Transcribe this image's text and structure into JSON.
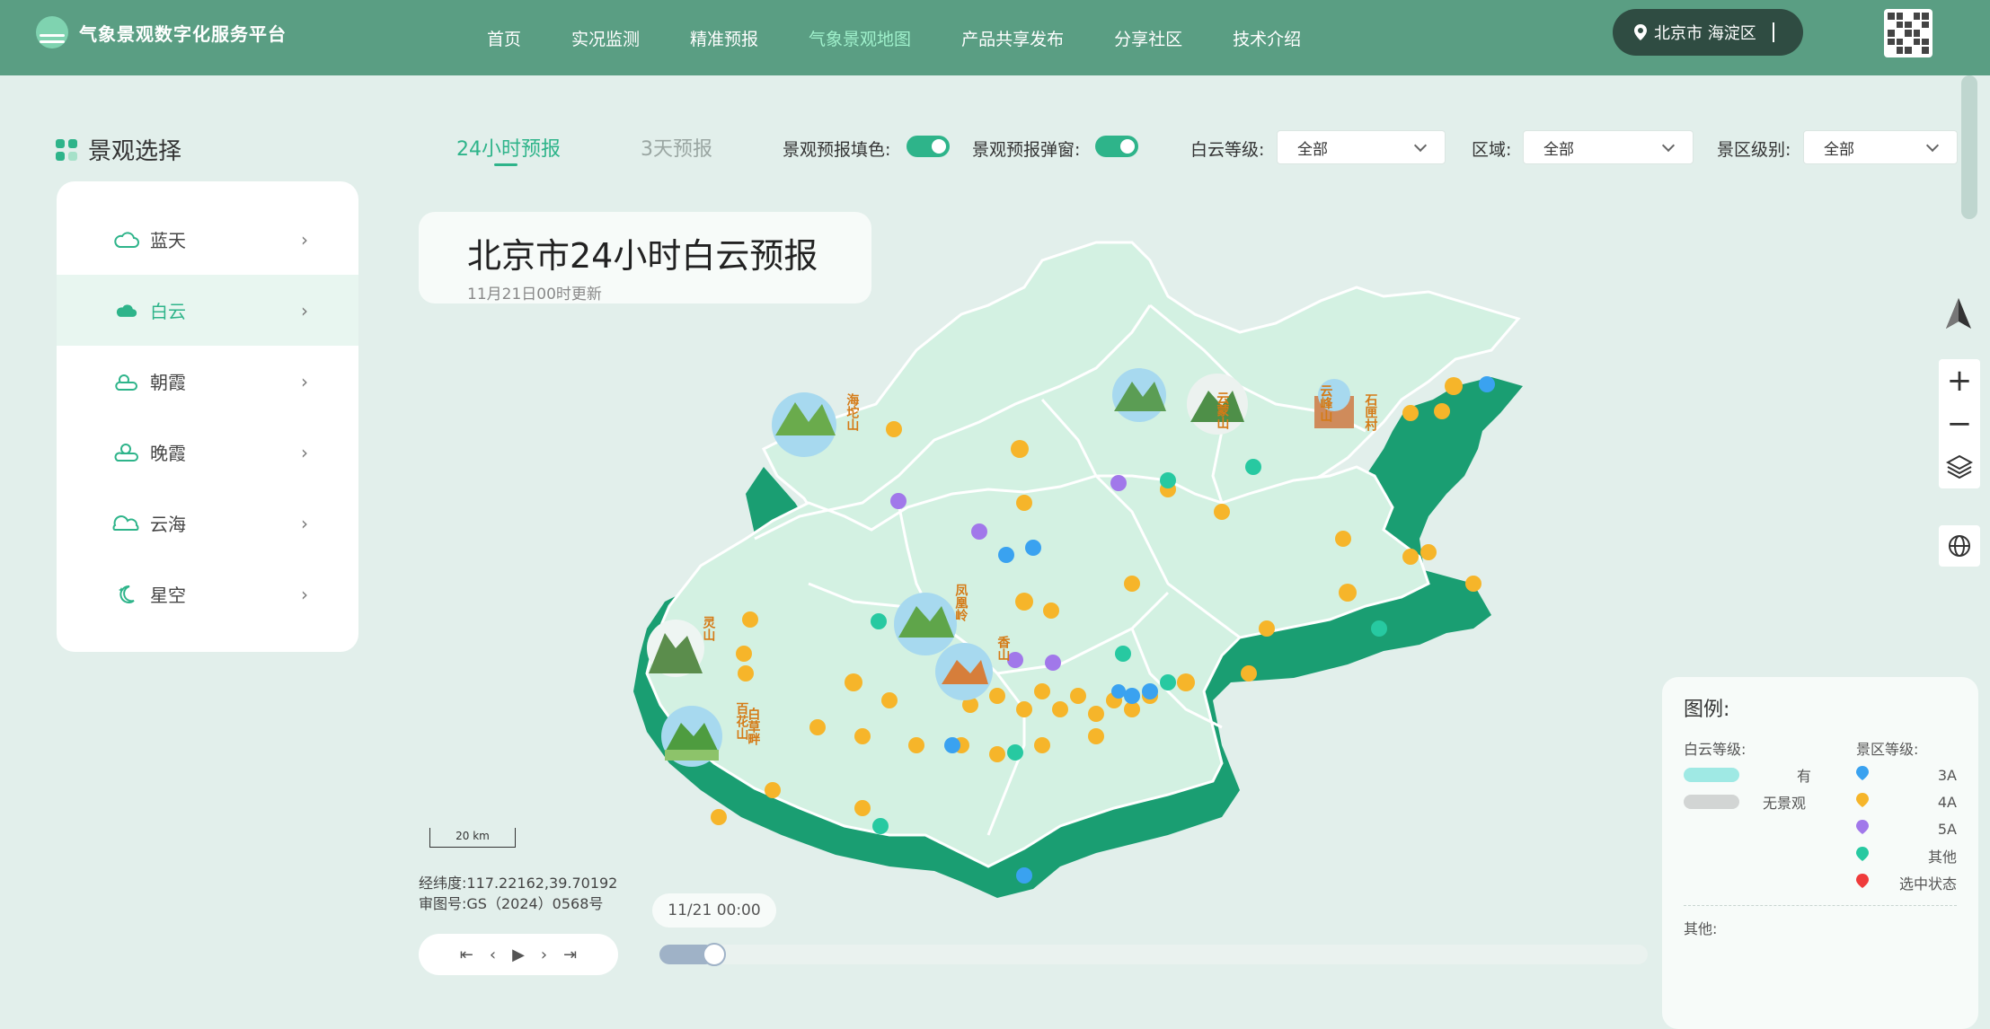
{
  "header": {
    "logo_text": "气象景观数字化服务平台",
    "nav": [
      "首页",
      "实况监测",
      "精准预报",
      "气象景观地图",
      "产品共享发布",
      "分享社区",
      "技术介绍"
    ],
    "active_nav": "气象景观地图",
    "location": "北京市 海淀区",
    "icons": {
      "logo": "logo-icon",
      "location": "map-pin-icon",
      "qr": "qr-code-icon"
    }
  },
  "sidebar": {
    "title": "景观选择",
    "items": [
      {
        "label": "蓝天",
        "icon": "cloud-outline-icon"
      },
      {
        "label": "白云",
        "icon": "cloud-filled-icon",
        "active": true
      },
      {
        "label": "朝霞",
        "icon": "sunrise-icon"
      },
      {
        "label": "晚霞",
        "icon": "sunset-icon"
      },
      {
        "label": "云海",
        "icon": "cloud-sea-icon"
      },
      {
        "label": "星空",
        "icon": "starry-sky-icon"
      }
    ]
  },
  "toolbar": {
    "tab_24h": "24小时预报",
    "tab_3d": "3天预报",
    "fill_label": "景观预报填色:",
    "fill_on": true,
    "popup_label": "景观预报弹窗:",
    "popup_on": true,
    "cloud_level_label": "白云等级:",
    "cloud_level_value": "全部",
    "region_label": "区域:",
    "region_value": "全部",
    "scenic_level_label": "景区级别:",
    "scenic_level_value": "全部"
  },
  "title_card": {
    "title": "北京市24小时白云预报",
    "updated": "11月21日00时更新"
  },
  "map": {
    "fill_color": "#d3f1e2",
    "edge_color": "#1a9e72",
    "pois": [
      "海坨山",
      "云蒙山",
      "云峰山",
      "石匣村",
      "凤凰岭",
      "香山",
      "灵山",
      "百花山",
      "白草畔"
    ]
  },
  "footer": {
    "scale": "20 km",
    "coord_label": "经纬度:",
    "coord_value": "117.22162,39.70192",
    "review_label": "审图号:",
    "review_value": "GS（2024）0568号",
    "time": "11/21 00:00",
    "timeline_progress": 0.03
  },
  "legend": {
    "title": "图例:",
    "cloud_level_title": "白云等级:",
    "cloud_levels": [
      {
        "label": "有",
        "color": "#9fe9e4"
      },
      {
        "label": "无景观",
        "color": "#d2d5d4"
      }
    ],
    "scenic_level_title": "景区等级:",
    "scenic_levels": [
      {
        "label": "3A",
        "color": "#3aa2f0"
      },
      {
        "label": "4A",
        "color": "#f6b52a"
      },
      {
        "label": "5A",
        "color": "#a178ea"
      },
      {
        "label": "其他",
        "color": "#27c9a1"
      },
      {
        "label": "选中状态",
        "color": "#ef3b3b"
      }
    ],
    "other_title": "其他:"
  }
}
